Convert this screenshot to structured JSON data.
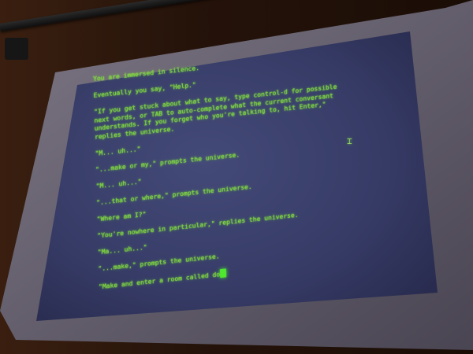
{
  "terminal": {
    "lines": [
      "You are immersed in silence.",
      "",
      "Eventually you say, \"Help.\"",
      "",
      "\"If you get stuck about what to say, type control-d for possible",
      "next words, or TAB to auto-complete what the current conversant",
      "understands. If you forget who you're talking to, hit Enter,\"",
      "replies the universe.",
      "",
      "\"M... uh...\"",
      "",
      "\"...make or my,\" prompts the universe.",
      "",
      "\"M... uh...\"",
      "",
      "\"...that or where,\" prompts the universe.",
      "",
      "\"Where am I?\"",
      "",
      "\"You're nowhere in particular,\" replies the universe.",
      "",
      "\"Ma... uh...\"",
      "",
      "\"...make,\" prompts the universe.",
      "",
      "\"Make and enter a room called do"
    ]
  },
  "colors": {
    "text": "#7fd43a",
    "cursor": "#4fe82e",
    "screen": "#3a3f6a",
    "frame": "#6e6a78"
  },
  "icons": {
    "text_cursor": "i-beam-icon"
  }
}
